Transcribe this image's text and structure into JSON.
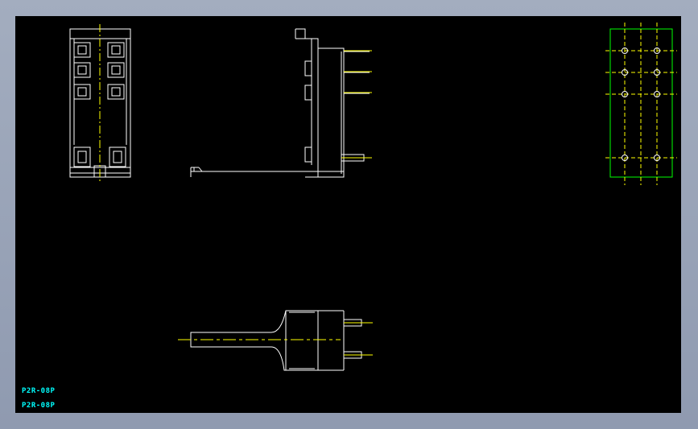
{
  "colors": {
    "background": "#000000",
    "outline": "#ffffff",
    "centerline": "#ffff00",
    "pattern": "#00ff00",
    "label": "#00ffff"
  },
  "labels": [
    "P2R-08P",
    "P2R-08P"
  ]
}
